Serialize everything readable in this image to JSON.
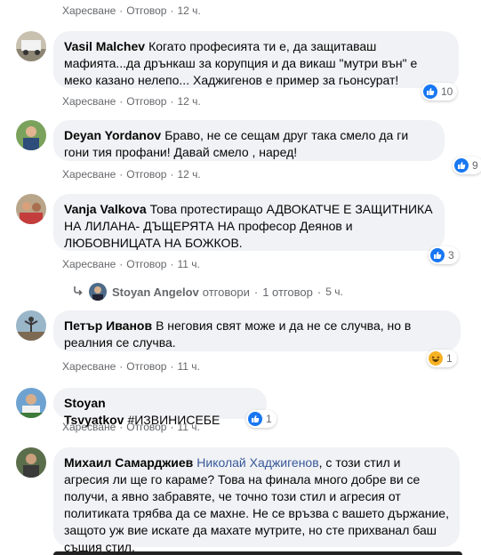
{
  "labels": {
    "like": "Харесване",
    "reply": "Отговор",
    "dot": "·"
  },
  "comments": [
    {
      "time": "12 ч."
    },
    {
      "author": "Vasil Malchev",
      "text": "Когато професията ти е, да защитаваш мафията...да дрънкаш за корупция и да викаш \"мутри вън\" е меко казано нелепо... Хаджигенов е пример за гьонсурат!",
      "time": "12 ч.",
      "reaction": "like",
      "reaction_count": "10"
    },
    {
      "author": "Deyan Yordanov",
      "text": "Браво, не се сещам друг така смело да ги гони тия профани! Давай смело , наред!",
      "time": "12 ч.",
      "reaction": "like",
      "reaction_count": "9"
    },
    {
      "author": "Vanja Valkova",
      "text": "Това протестиращо АДВОКАТЧЕ Е ЗАЩИТНИКА НА ЛИЛАНА- ДЪЩЕРЯТА НА професор Деянов и ЛЮБОВНИЦАТА НА БОЖКОВ.",
      "time": "11 ч.",
      "reaction": "like",
      "reaction_count": "3",
      "reply": {
        "author": "Stoyan Angelov",
        "verb": "отговори",
        "count": "1 отговор",
        "time": "5 ч."
      }
    },
    {
      "author": "Петър Иванов",
      "text": "В неговия свят може и да не се случва, но в реалния се случва.",
      "time": "11 ч.",
      "reaction": "haha",
      "reaction_count": "1"
    },
    {
      "author": "Stoyan Tsvyatkov",
      "text": "#ИЗВИНИСЕБЕ",
      "time": "11 ч.",
      "reaction": "like",
      "reaction_count": "1"
    },
    {
      "author": "Михаил Самарджиев",
      "mention": "Николай Хаджигенов",
      "text": ", с този стил и агресия ли ще го караме? Това на финала много добре ви се получи, а явно забравяте, че точно този стил и агресия от политиката трябва да се махне. Не се връзва с вашето държание, защото уж вие искате да махате мутрите, но сте прихванал баш същия стил."
    }
  ],
  "colors": {
    "bubble": "#f0f2f5",
    "like": "#1877f2",
    "haha": "#f7b125",
    "meta": "#65676b",
    "mention": "#385898"
  }
}
